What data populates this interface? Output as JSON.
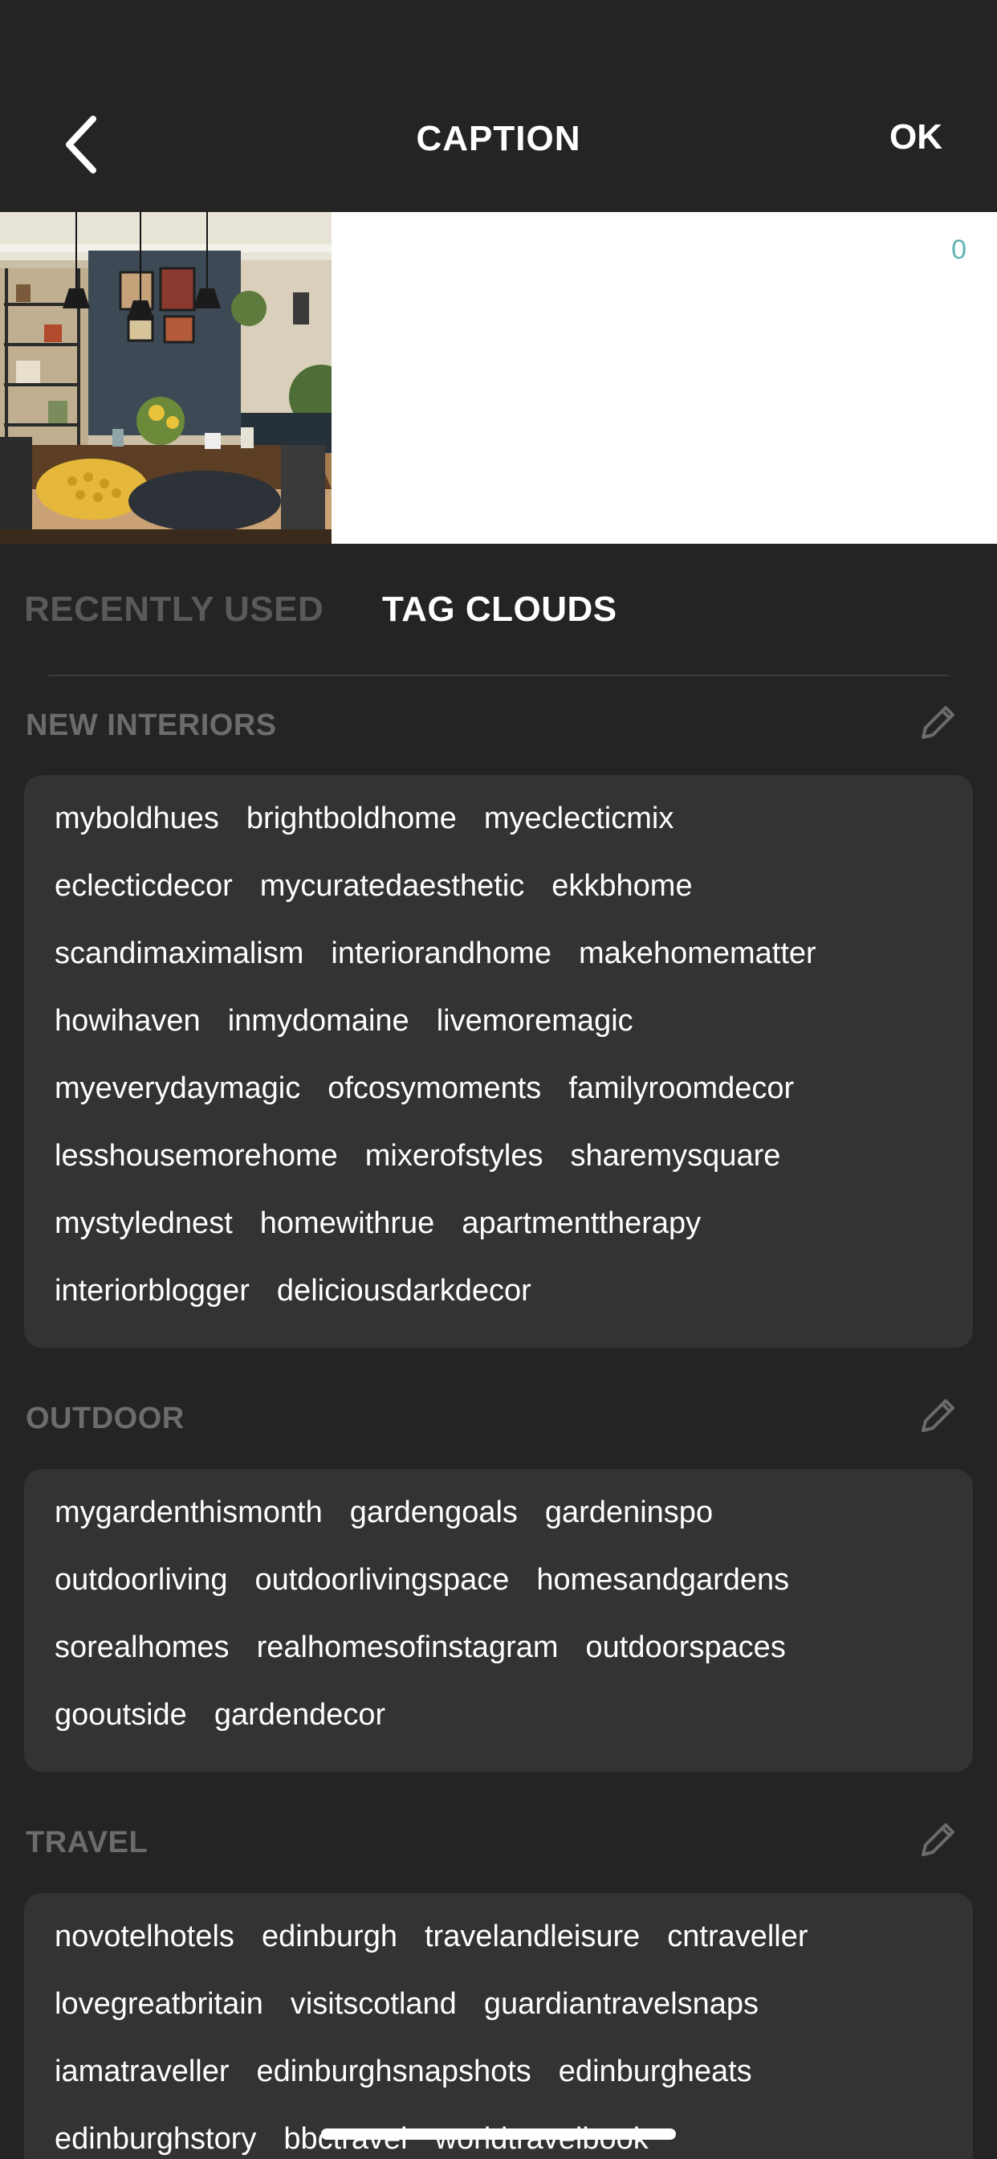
{
  "header": {
    "title": "CAPTION",
    "ok_label": "OK"
  },
  "caption": {
    "char_count": "0",
    "placeholder": ""
  },
  "tabs": {
    "recently_used": "RECENTLY USED",
    "tag_clouds": "TAG CLOUDS"
  },
  "sections": [
    {
      "title": "NEW INTERIORS",
      "lines": [
        [
          "myboldhues",
          "brightboldhome",
          "myeclecticmix"
        ],
        [
          "eclecticdecor",
          "mycuratedaesthetic",
          "ekkbhome"
        ],
        [
          "scandimaximalism",
          "interiorandhome",
          "makehomematter"
        ],
        [
          "howihaven",
          "inmydomaine",
          "livemoremagic"
        ],
        [
          "myeverydaymagic",
          "ofcosymoments",
          "familyroomdecor"
        ],
        [
          "lesshousemorehome",
          "mixerofstyles",
          "sharemysquare"
        ],
        [
          "mystylednest",
          "homewithrue",
          "apartmenttherapy"
        ],
        [
          "interiorblogger",
          "deliciousdarkdecor"
        ]
      ]
    },
    {
      "title": "OUTDOOR",
      "lines": [
        [
          "mygardenthismonth",
          "gardengoals",
          "gardeninspo"
        ],
        [
          "outdoorliving",
          "outdoorlivingspace",
          "homesandgardens"
        ],
        [
          "sorealhomes",
          "realhomesofinstagram",
          "outdoorspaces"
        ],
        [
          "gooutside",
          "gardendecor"
        ]
      ]
    },
    {
      "title": "TRAVEL",
      "lines": [
        [
          "novotelhotels",
          "edinburgh",
          "travelandleisure",
          "cntraveller"
        ],
        [
          "lovegreatbritain",
          "visitscotland",
          "guardiantravelsnaps"
        ],
        [
          "iamatraveller",
          "edinburghsnapshots",
          "edinburgheats"
        ],
        [
          "edinburghstory",
          "bbctravel",
          "worldtravelbook"
        ]
      ]
    }
  ]
}
